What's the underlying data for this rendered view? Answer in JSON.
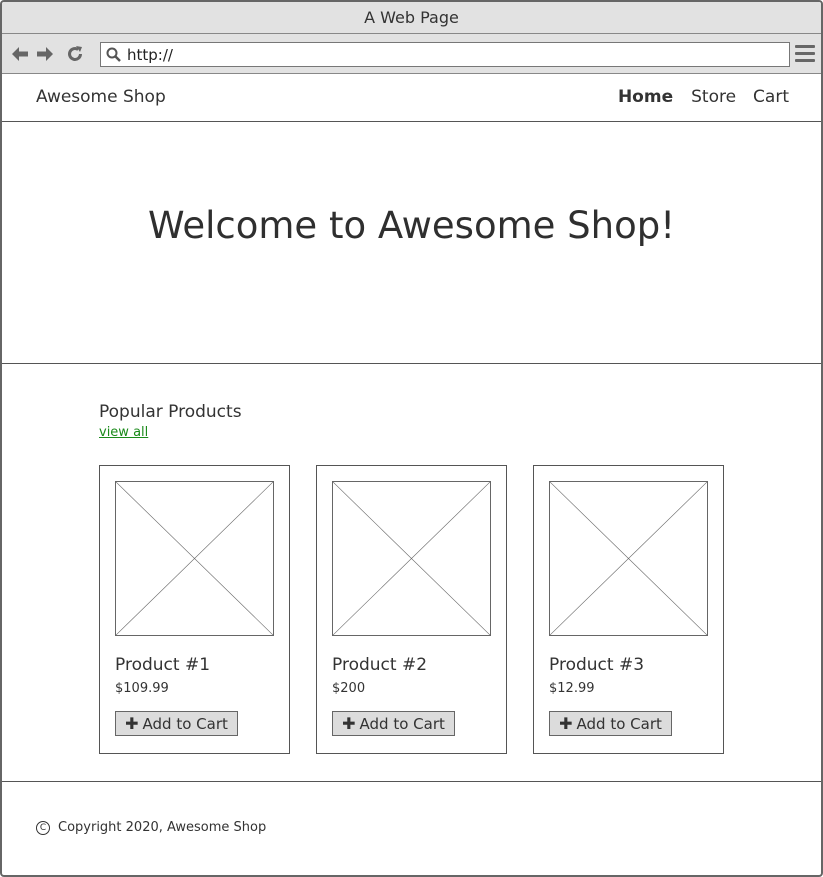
{
  "browser": {
    "title": "A Web Page",
    "url": "http://"
  },
  "site": {
    "brand": "Awesome Shop",
    "nav": [
      {
        "label": "Home"
      },
      {
        "label": "Store"
      },
      {
        "label": "Cart"
      }
    ]
  },
  "hero": {
    "heading": "Welcome to Awesome Shop!"
  },
  "popular": {
    "title": "Popular Products",
    "view_all": "view all",
    "products": [
      {
        "name": "Product #1",
        "price": "$109.99",
        "button": "Add to Cart"
      },
      {
        "name": "Product #2",
        "price": "$200",
        "button": "Add to Cart"
      },
      {
        "name": "Product #3",
        "price": "$12.99",
        "button": "Add to Cart"
      }
    ]
  },
  "footer": {
    "copyright_symbol": "C",
    "copyright": "Copyright 2020, Awesome Shop"
  },
  "colors": {
    "link": "#1a8a1a",
    "chrome": "#e2e2e2"
  }
}
